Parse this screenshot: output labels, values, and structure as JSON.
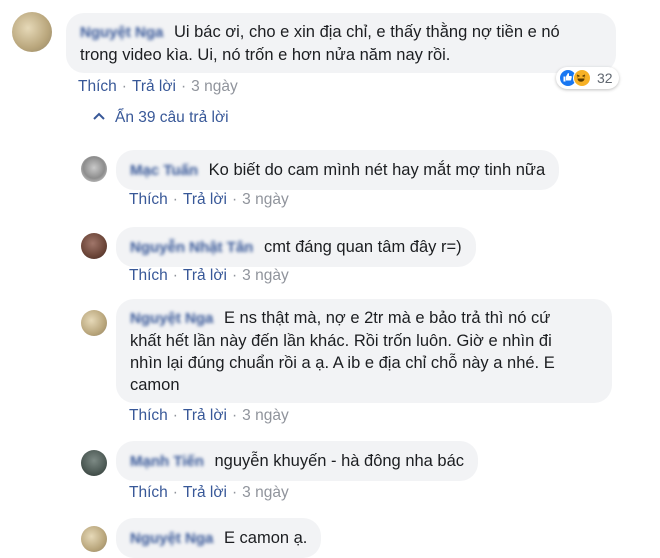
{
  "main_comment": {
    "author": "Nguyệt Nga",
    "text_line1": "Ui bác ơi, cho e xin địa chỉ, e thấy thằng nợ tiền e nó",
    "text_line2": "trong video kìa. Ui, nó trốn e hơn nửa năm nay rồi.",
    "like_label": "Thích",
    "reply_label": "Trả lời",
    "time": "3 ngày",
    "reaction_count": "32",
    "reaction_icons": [
      "like-icon",
      "haha-icon"
    ]
  },
  "hide_replies_label": "Ẩn 39 câu trả lời",
  "replies": [
    {
      "author": "Mạc Tuấn",
      "text": "Ko biết do cam mình nét hay mắt mợ tinh nữa",
      "like_label": "Thích",
      "reply_label": "Trả lời",
      "time": "3 ngày"
    },
    {
      "author": "Nguyễn Nhật Tân",
      "text": "cmt đáng quan tâm đây r=)",
      "like_label": "Thích",
      "reply_label": "Trả lời",
      "time": "3 ngày"
    },
    {
      "author": "Nguyệt Nga",
      "text_line1": "E ns thật mà, nợ e 2tr mà e bảo trả thì nó cứ",
      "text_line2": "khất hết lần này đến lần khác. Rồi trốn luôn. Giờ e nhìn đi",
      "text_line3": "nhìn lại đúng chuẩn rồi a ạ. A ib e địa chỉ chỗ này a nhé. E",
      "text_line4": "camon",
      "like_label": "Thích",
      "reply_label": "Trả lời",
      "time": "3 ngày"
    },
    {
      "author": "Mạnh Tiến",
      "text": "nguyễn khuyến - hà đông nha bác",
      "like_label": "Thích",
      "reply_label": "Trả lời",
      "time": "3 ngày"
    },
    {
      "author": "Nguyệt Nga",
      "text": "E camon ạ."
    }
  ],
  "colors": {
    "link": "#385898",
    "meta": "#90949c",
    "bubble": "#f2f3f5"
  }
}
